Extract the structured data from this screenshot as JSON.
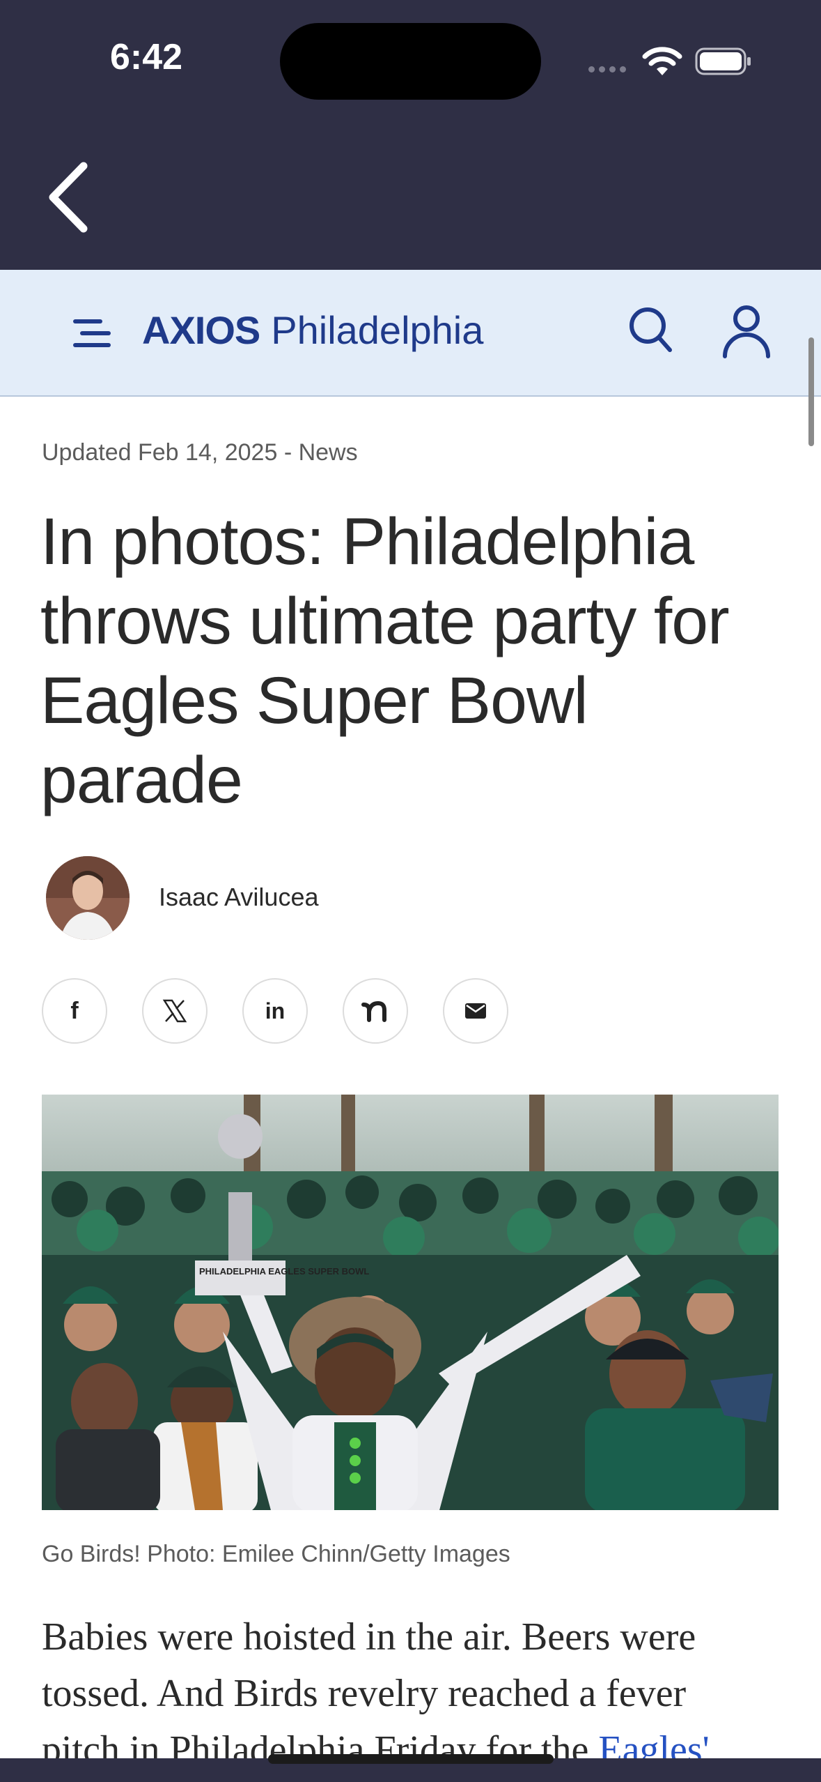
{
  "status_bar": {
    "time": "6:42"
  },
  "header": {
    "logo_brand": "AXIOS",
    "logo_city": "Philadelphia"
  },
  "article": {
    "meta": "Updated Feb 14, 2025 - News",
    "headline": "In photos: Philadelphia throws ultimate party for Eagles Super Bowl parade",
    "author": "Isaac Avilucea",
    "share_icons": [
      "facebook-icon",
      "x-icon",
      "linkedin-icon",
      "nextdoor-icon",
      "email-icon"
    ],
    "share_glyphs": {
      "facebook": "f",
      "linkedin": "in"
    },
    "trophy_text": "PHILADELPHIA EAGLES SUPER BOWL",
    "caption": "Go Birds! Photo: Emilee Chinn/Getty Images",
    "body_line1": "Babies were hoisted in the air. Beers were",
    "body_line2": "tossed. And Birds revelry reached a fever",
    "body_line3": "pitch in Philadelphia Friday for the ",
    "body_link": "Eagles'"
  },
  "colors": {
    "nav_bg": "#2f2f45",
    "header_bg": "#e3edf9",
    "brand": "#1f3a8a",
    "link": "#2551c2"
  }
}
